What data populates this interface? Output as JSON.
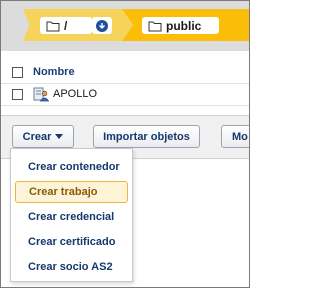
{
  "breadcrumb": {
    "root_label": "/",
    "current_label": "public"
  },
  "table": {
    "column_name": "Nombre",
    "rows": [
      {
        "name": "APOLLO",
        "icon": "user-account-icon"
      }
    ]
  },
  "toolbar": {
    "create_label": "Crear",
    "import_label": "Importar objetos",
    "more_label": "Mo"
  },
  "create_menu": {
    "items": [
      {
        "label": "Crear contenedor",
        "highlighted": false
      },
      {
        "label": "Crear trabajo",
        "highlighted": true
      },
      {
        "label": "Crear credencial",
        "highlighted": false
      },
      {
        "label": "Crear certificado",
        "highlighted": false
      },
      {
        "label": "Crear socio AS2",
        "highlighted": false
      }
    ]
  },
  "colors": {
    "breadcrumb_root": "#f6d35a",
    "breadcrumb_current": "#fbbd08",
    "link_text": "#16386d",
    "highlight_bg": "#fdf3d8",
    "highlight_border": "#e8b93a"
  }
}
